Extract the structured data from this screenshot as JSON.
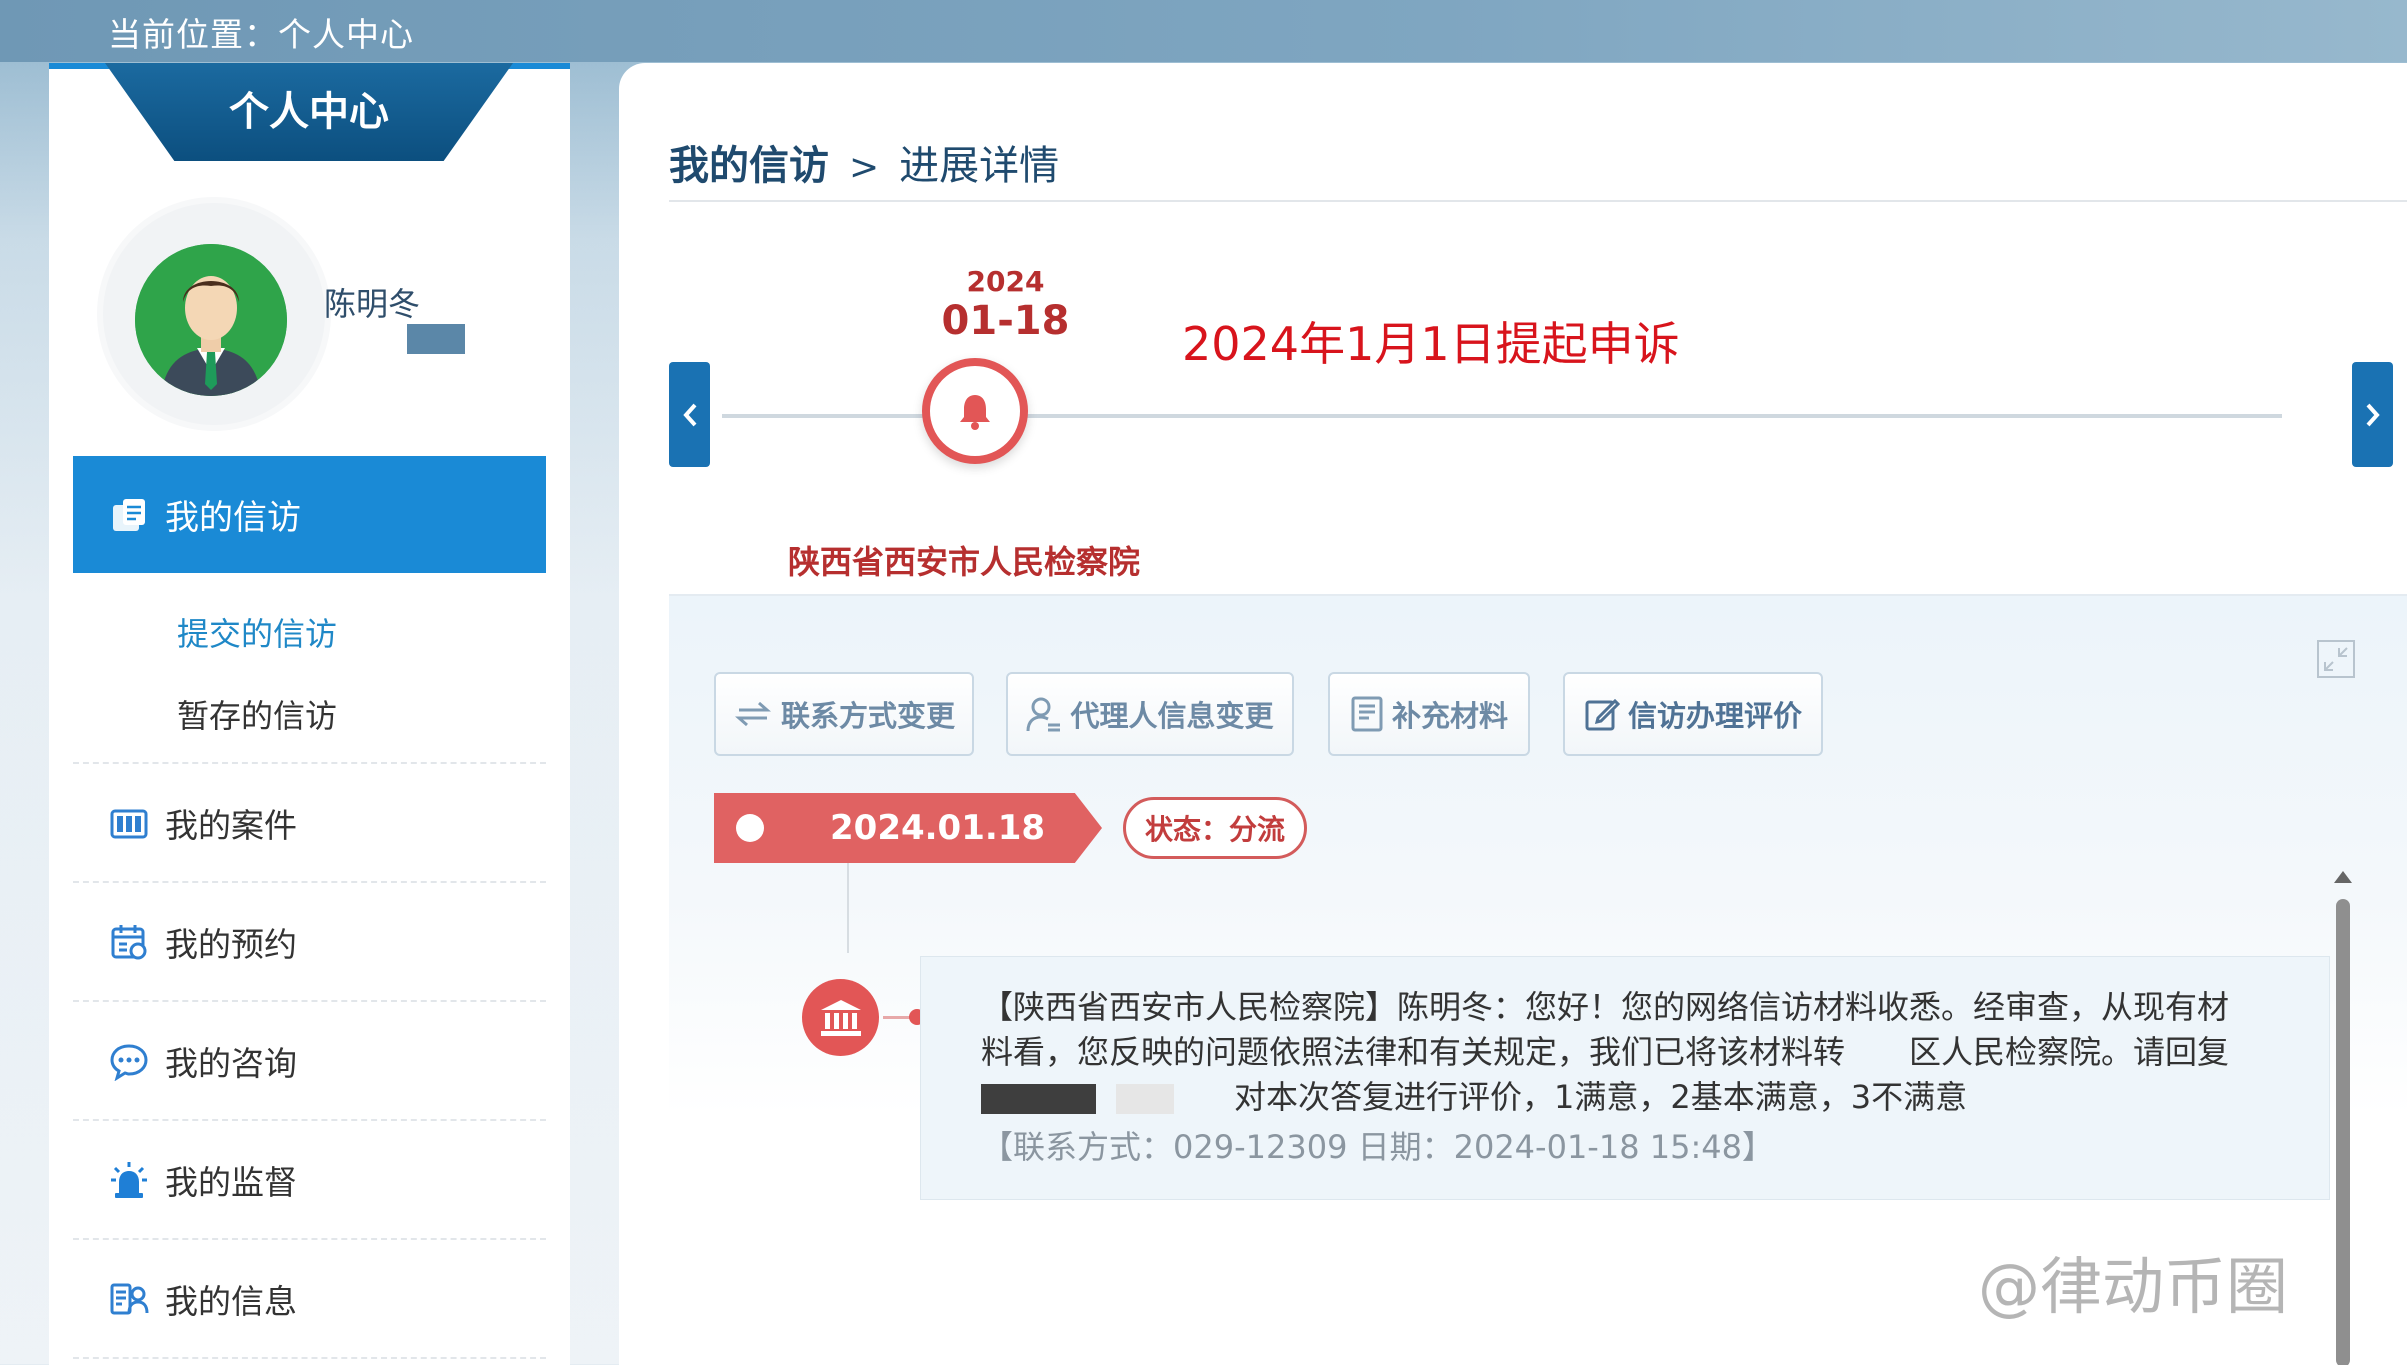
{
  "header": {
    "location": "当前位置：个人中心"
  },
  "sidebar": {
    "title": "个人中心",
    "user": {
      "name": "陈明冬"
    },
    "active_item": {
      "label": "我的信访",
      "icon": "petition-icon"
    },
    "sub_items": [
      {
        "label": "提交的信访",
        "active": true
      },
      {
        "label": "暂存的信访",
        "active": false
      }
    ],
    "items": [
      {
        "label": "我的案件",
        "icon": "case-icon"
      },
      {
        "label": "我的预约",
        "icon": "calendar-icon"
      },
      {
        "label": "我的咨询",
        "icon": "chat-icon"
      },
      {
        "label": "我的监督",
        "icon": "siren-icon"
      },
      {
        "label": "我的信息",
        "icon": "user-info-icon"
      }
    ]
  },
  "main": {
    "breadcrumb": {
      "root": "我的信访",
      "separator": ">",
      "current": "进展详情"
    },
    "timeline": {
      "year": "2024",
      "date": "01-18",
      "title": "2024年1月1日提起申诉",
      "org": "陕西省西安市人民检察院"
    },
    "actions": [
      {
        "label": "联系方式变更",
        "icon": "transfer-icon"
      },
      {
        "label": "代理人信息变更",
        "icon": "agent-icon"
      },
      {
        "label": "补充材料",
        "icon": "document-icon"
      },
      {
        "label": "信访办理评价",
        "icon": "edit-icon"
      }
    ],
    "record": {
      "date": "2024.01.18",
      "status": "状态：分流",
      "message_line1": "【陕西省西安市人民检察院】陈明冬：您好！您的网络信访材料收悉。经审查，从现有材",
      "message_line2": "料看，您反映的问题依照法律和有关规定，我们已将该材料转　　区人民检察院。请回复",
      "message_line3": "对本次答复进行评价，1满意，2基本满意，3不满意",
      "contact": "【联系方式：029-12309 日期：2024-01-18 15:48】"
    }
  },
  "watermark": "@律动币圈",
  "colors": {
    "accent": "#1a8ad6",
    "danger": "#e25656",
    "title_red": "#d8141c",
    "nav_dark": "#0c4f7f"
  }
}
